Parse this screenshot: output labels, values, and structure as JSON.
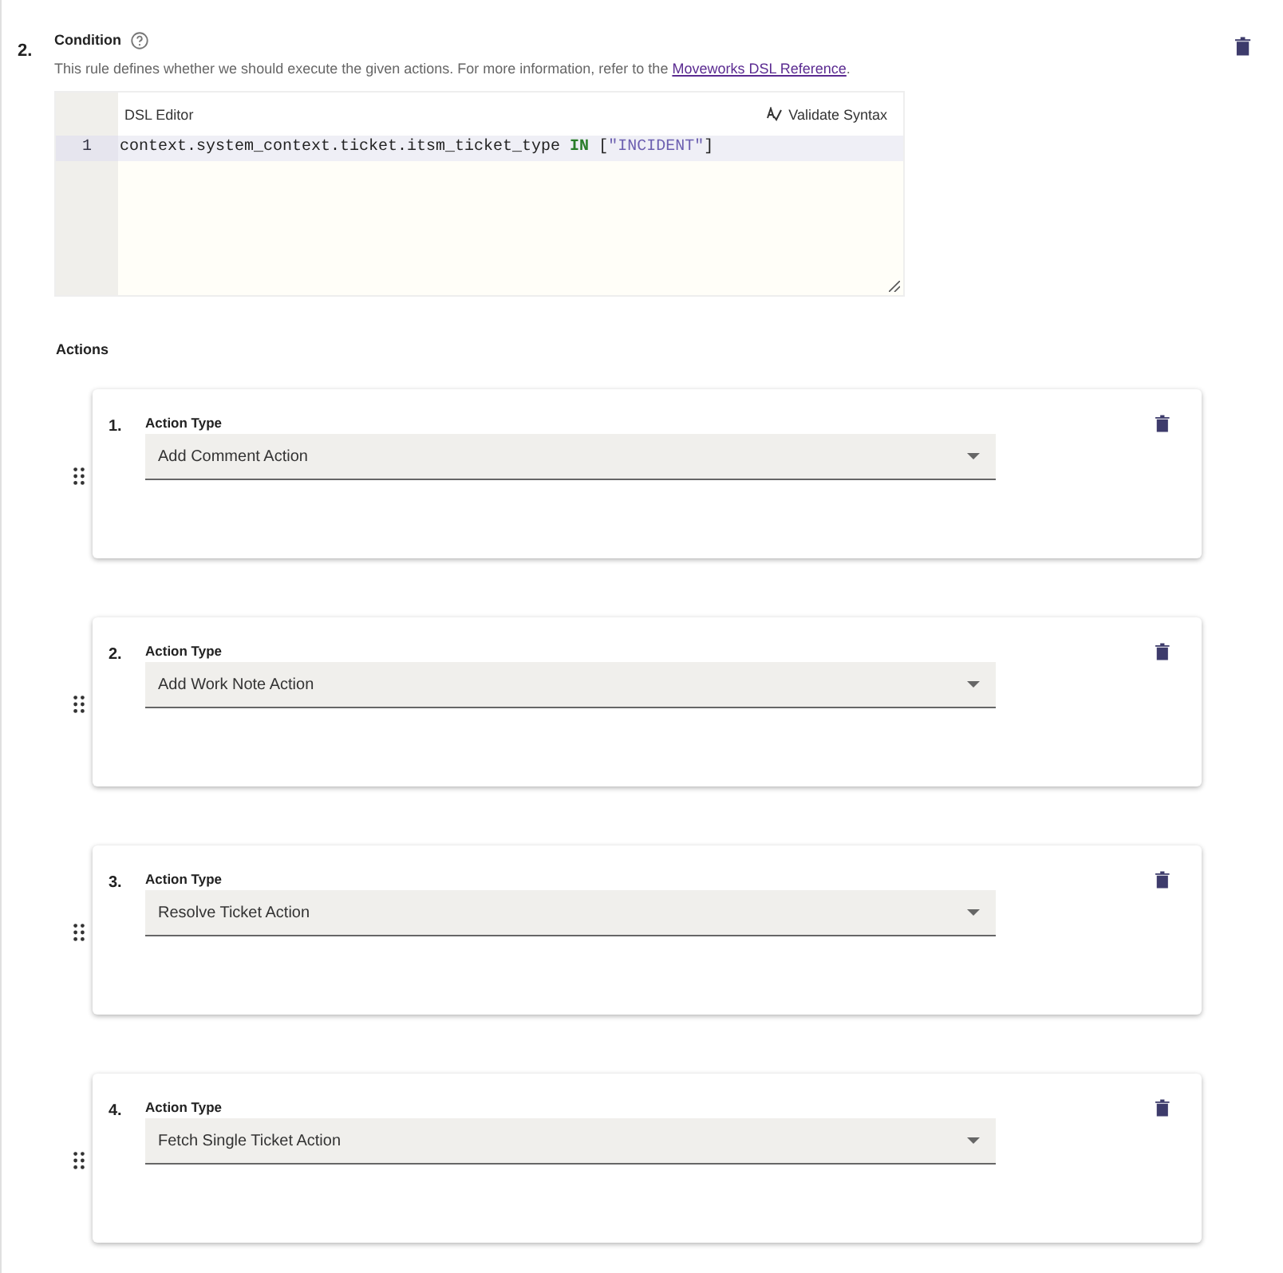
{
  "condition": {
    "number": "2.",
    "title": "Condition",
    "description": "This rule defines whether we should execute the given actions. For more information, refer to the ",
    "link": "Moveworks DSL Reference",
    "after_link": ".",
    "editor": {
      "title": "DSL Editor",
      "validate_label": "Validate Syntax",
      "lines": [
        {
          "number": "1",
          "tokens": [
            {
              "kind": "plain",
              "text": "context.system_context.ticket.itsm_ticket_type "
            },
            {
              "kind": "keyword",
              "text": "IN"
            },
            {
              "kind": "plain",
              "text": " ["
            },
            {
              "kind": "string",
              "text": "\"INCIDENT\""
            },
            {
              "kind": "plain",
              "text": "]"
            }
          ]
        }
      ]
    }
  },
  "actions_label": "Actions",
  "actions": [
    {
      "number": "1.",
      "label": "Action Type",
      "value": "Add Comment Action"
    },
    {
      "number": "2.",
      "label": "Action Type",
      "value": "Add Work Note Action"
    },
    {
      "number": "3.",
      "label": "Action Type",
      "value": "Resolve Ticket Action"
    },
    {
      "number": "4.",
      "label": "Action Type",
      "value": "Fetch Single Ticket Action"
    }
  ]
}
